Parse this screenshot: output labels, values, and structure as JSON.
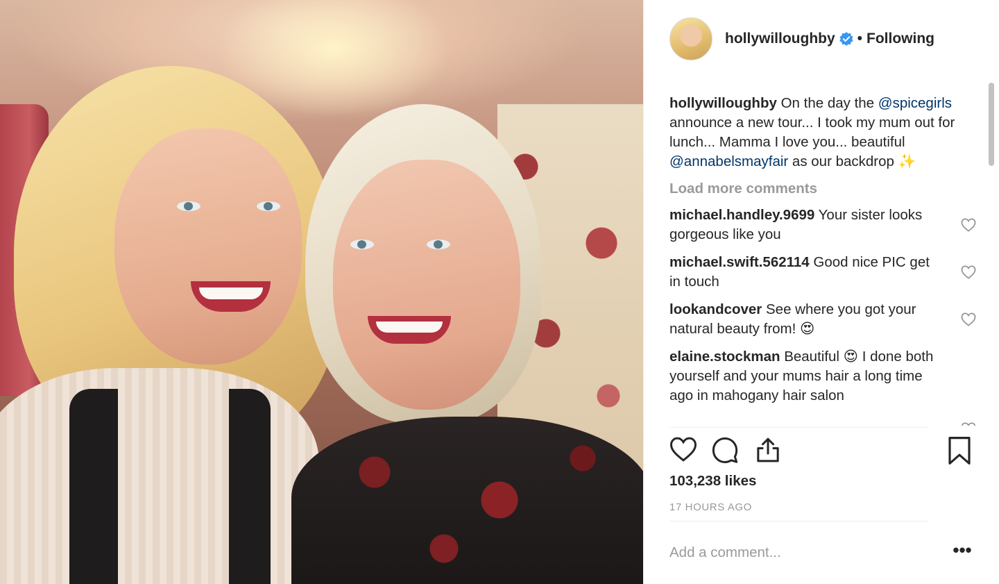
{
  "post": {
    "username": "hollywilloughby",
    "separator": "•",
    "follow_state": "Following",
    "verified": true,
    "caption": {
      "username": "hollywilloughby",
      "text_1": " On the day the ",
      "mention_1": "@spicegirls",
      "text_2": " announce a new tour... I took my mum out for lunch... Mamma I love you... beautiful ",
      "mention_2": "@annabelsmayfair",
      "text_3": " as our backdrop ✨"
    },
    "load_more": "Load more comments",
    "comments": [
      {
        "username": "michael.handley.9699",
        "text": " Your sister looks gorgeous like you"
      },
      {
        "username": "michael.swift.562114",
        "text": " Good nice PIC get in touch"
      },
      {
        "username": "lookandcover",
        "text": " See where you got your natural beauty from! 😍"
      },
      {
        "username": "elaine.stockman",
        "text": " Beautiful 😍 I done both yourself and your mums hair a long time ago in mahogany hair salon"
      }
    ],
    "likes": "103,238 likes",
    "timestamp": "17 HOURS AGO",
    "add_comment_placeholder": "Add a comment...",
    "more_options": "•••"
  },
  "icons": {
    "verified": "verified-badge-icon",
    "like": "heart-icon",
    "comment": "comment-icon",
    "share": "share-icon",
    "save": "bookmark-icon",
    "comment_like": "heart-icon"
  },
  "colors": {
    "text": "#262626",
    "muted": "#999999",
    "mention": "#003569",
    "verified": "#3897f0"
  }
}
